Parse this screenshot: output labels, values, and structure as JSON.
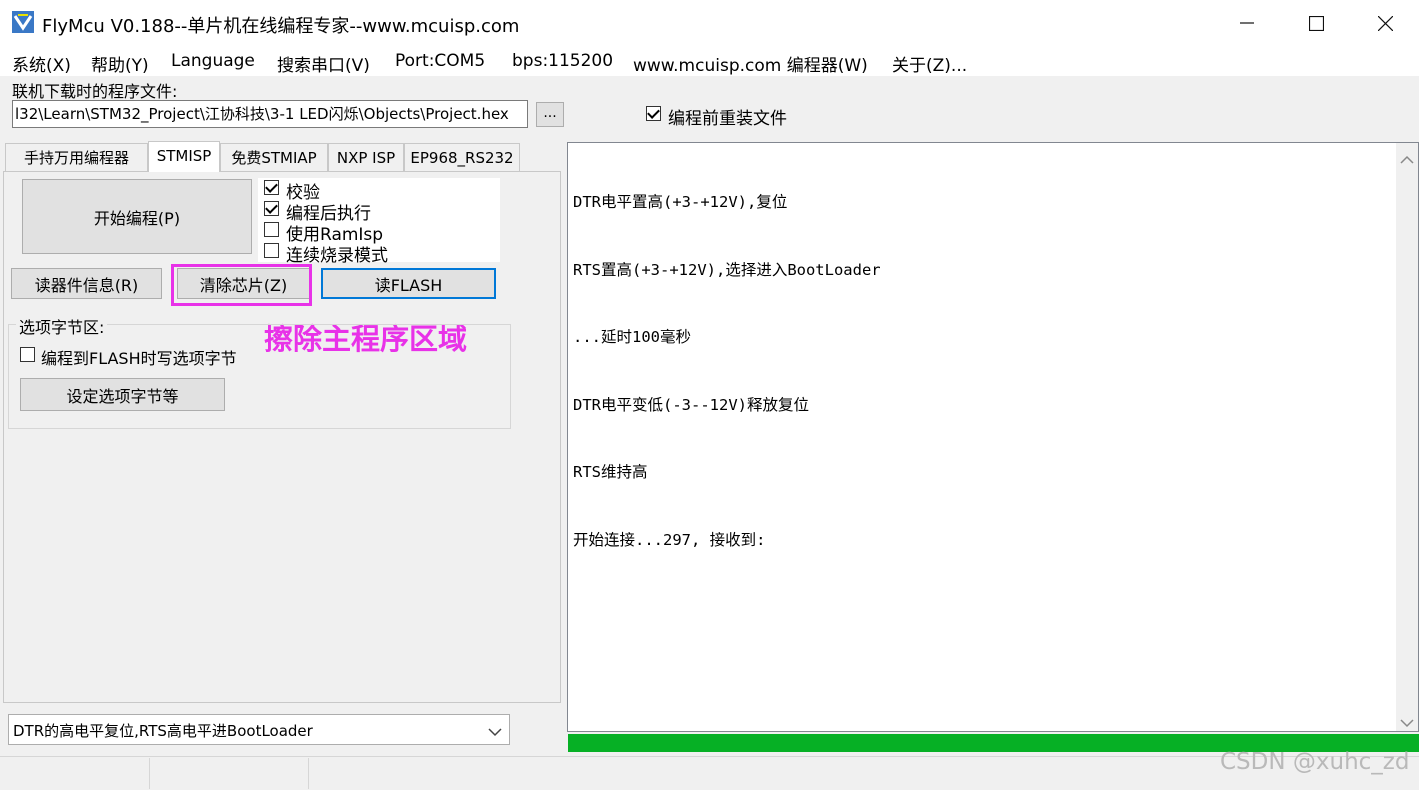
{
  "window": {
    "title": "FlyMcu V0.188--单片机在线编程专家--www.mcuisp.com",
    "minimize": "—",
    "maximize": "☐",
    "close": "✕"
  },
  "menu": [
    "系统(X)",
    "帮助(Y)",
    "Language",
    "搜索串口(V)",
    "Port:COM5",
    "bps:115200",
    "www.mcuisp.com 编程器(W)",
    "关于(Z)..."
  ],
  "file": {
    "label": "联机下载时的程序文件:",
    "path": "l32\\Learn\\STM32_Project\\江协科技\\3-1 LED闪烁\\Objects\\Project.hex",
    "browse": "...",
    "reload_label": "编程前重装文件",
    "reload_checked": true
  },
  "tabs": [
    "手持万用编程器",
    "STMISP",
    "免费STMIAP",
    "NXP ISP",
    "EP968_RS232"
  ],
  "active_tab": 1,
  "stmisp": {
    "start_button": "开始编程(P)",
    "options": [
      {
        "label": "校验",
        "checked": true
      },
      {
        "label": "编程后执行",
        "checked": true
      },
      {
        "label": "使用RamIsp",
        "checked": false
      },
      {
        "label": "连续烧录模式",
        "checked": false
      }
    ],
    "read_info_button": "读器件信息(R)",
    "erase_button": "清除芯片(Z)",
    "read_flash_button": "读FLASH",
    "annotation": "擦除主程序区域",
    "annotation_color": "#e832e8",
    "option_bytes": {
      "group_label": "选项字节区:",
      "write_label": "编程到FLASH时写选项字节",
      "write_checked": false,
      "set_button": "设定选项字节等"
    }
  },
  "reset_mode": "DTR的高电平复位,RTS高电平进BootLoader",
  "log_lines": [
    "DTR电平置高(+3-+12V),复位",
    "RTS置高(+3-+12V),选择进入BootLoader",
    "...延时100毫秒",
    "DTR电平变低(-3--12V)释放复位",
    "RTS维持高",
    "开始连接...297, 接收到:"
  ],
  "progress": 1.0,
  "progress_color": "#06b025",
  "watermark": "CSDN @xuhc_zd"
}
